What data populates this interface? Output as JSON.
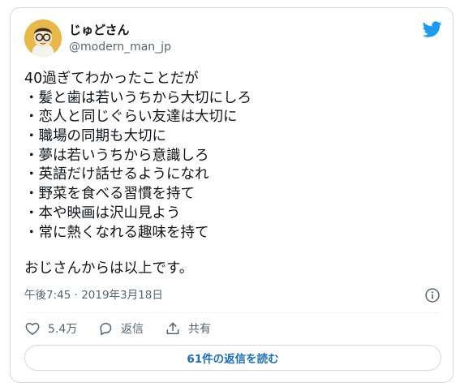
{
  "author": {
    "display_name": "じゅどさん",
    "handle": "@modern_man_jp",
    "avatar_icon": "cartoon-man-with-glasses-avatar"
  },
  "brand": {
    "icon": "twitter-bird-icon",
    "color": "#1d9bf0"
  },
  "tweet": {
    "intro": "40過ぎてわかったことだが",
    "items": [
      "・髪と歯は若いうちから大切にしろ",
      "・恋人と同じぐらい友達は大切に",
      "・職場の同期も大切に",
      "・夢は若いうちから意識しろ",
      "・英語だけ話せるようになれ",
      "・野菜を食べる習慣を持て",
      "・本や映画は沢山見よう",
      "・常に熱くなれる趣味を持て"
    ],
    "closing": "おじさんからは以上です。",
    "timestamp": "午後7:45 · 2019年3月18日"
  },
  "actions": {
    "like_count": "5.4万",
    "reply_label": "返信",
    "share_label": "共有"
  },
  "replies_button": {
    "label": "61件の返信を読む",
    "color": "#1d6fb5"
  }
}
